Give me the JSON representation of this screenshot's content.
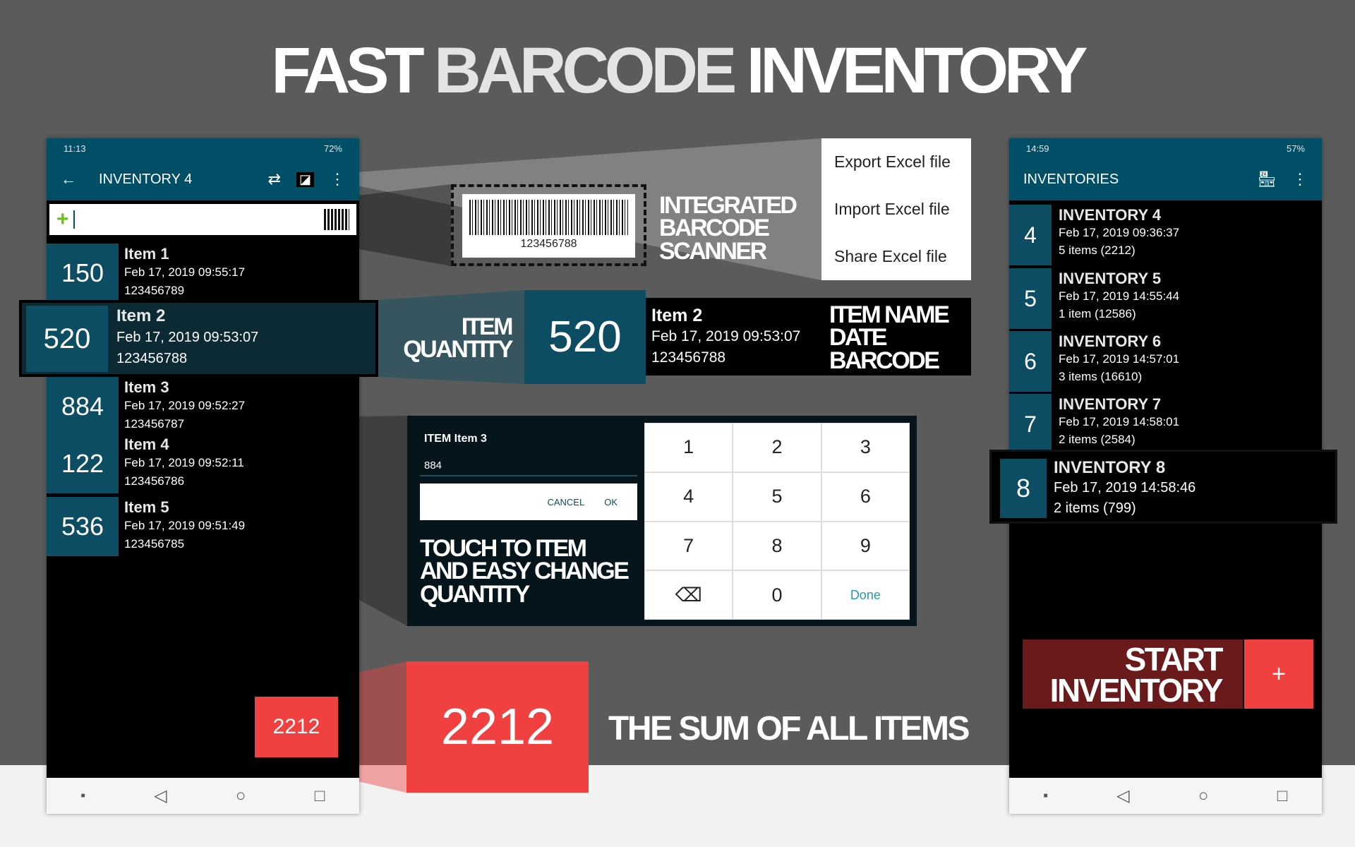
{
  "headline": {
    "part1": "FAST",
    "part2": "BARCODE",
    "part3": "INVENTORY"
  },
  "left_phone": {
    "status": {
      "time": "11:13",
      "battery": "72%"
    },
    "appbar": {
      "title": "INVENTORY 4",
      "back_icon": "arrow-left-icon",
      "sync_icon": "swap-icon",
      "add_icon": "add-box-icon",
      "menu_icon": "more-vert-icon"
    },
    "search": {
      "value": "",
      "add_icon": "plus-icon",
      "scan_icon": "barcode-icon"
    },
    "items": [
      {
        "qty": "150",
        "name": "Item 1",
        "date": "Feb 17, 2019 09:55:17",
        "barcode": "123456789"
      },
      {
        "qty": "520",
        "name": "Item 2",
        "date": "Feb 17, 2019 09:53:07",
        "barcode": "123456788"
      },
      {
        "qty": "884",
        "name": "Item 3",
        "date": "Feb 17, 2019 09:52:27",
        "barcode": "123456787"
      },
      {
        "qty": "122",
        "name": "Item 4",
        "date": "Feb 17, 2019 09:52:11",
        "barcode": "123456786"
      },
      {
        "qty": "536",
        "name": "Item 5",
        "date": "Feb 17, 2019 09:51:49",
        "barcode": "123456785"
      }
    ],
    "sum": "2212"
  },
  "menu": [
    "Export Excel file",
    "Import Excel file",
    "Share Excel file"
  ],
  "scanner": {
    "barcode_number": "123456788",
    "caption": [
      "INTEGRATED",
      "BARCODE",
      "SCANNER"
    ]
  },
  "callout_item": {
    "label": [
      "ITEM",
      "QUANTITY"
    ],
    "qty": "520",
    "name": "Item 2",
    "date": "Feb 17, 2019 09:53:07",
    "barcode": "123456788",
    "fields": [
      "ITEM NAME",
      "DATE",
      "BARCODE"
    ]
  },
  "dialog": {
    "title": "ITEM Item 3",
    "value": "884",
    "cancel": "CANCEL",
    "ok": "OK",
    "caption": [
      "TOUCH TO ITEM",
      "AND EASY CHANGE",
      "QUANTITY"
    ],
    "keys": [
      "1",
      "2",
      "3",
      "4",
      "5",
      "6",
      "7",
      "8",
      "9",
      "⌫",
      "0",
      "Done"
    ]
  },
  "sum_callout": {
    "value": "2212",
    "caption": "THE SUM OF ALL ITEMS"
  },
  "right_phone": {
    "status": {
      "time": "14:59",
      "battery": "57%"
    },
    "appbar": {
      "title": "INVENTORIES",
      "store_icon": "store-icon",
      "menu_icon": "more-vert-icon"
    },
    "inventories": [
      {
        "num": "4",
        "name": "INVENTORY 4",
        "date": "Feb 17, 2019 09:36:37",
        "count": "5 items (2212)"
      },
      {
        "num": "5",
        "name": "INVENTORY 5",
        "date": "Feb 17, 2019 14:55:44",
        "count": "1 item (12586)"
      },
      {
        "num": "6",
        "name": "INVENTORY 6",
        "date": "Feb 17, 2019 14:57:01",
        "count": "3 items (16610)"
      },
      {
        "num": "7",
        "name": "INVENTORY 7",
        "date": "Feb 17, 2019 14:58:01",
        "count": "2 items (2584)"
      },
      {
        "num": "8",
        "name": "INVENTORY 8",
        "date": "Feb 17, 2019 14:58:46",
        "count": "2 items (799)"
      }
    ],
    "start": {
      "line1": "START",
      "line2": "INVENTORY",
      "plus": "+"
    }
  },
  "colors": {
    "teal": "#0d4d63",
    "appbar": "#004f66",
    "red": "#f04040",
    "dark_red": "#6a1a1a",
    "background": "#5b5b5b"
  }
}
